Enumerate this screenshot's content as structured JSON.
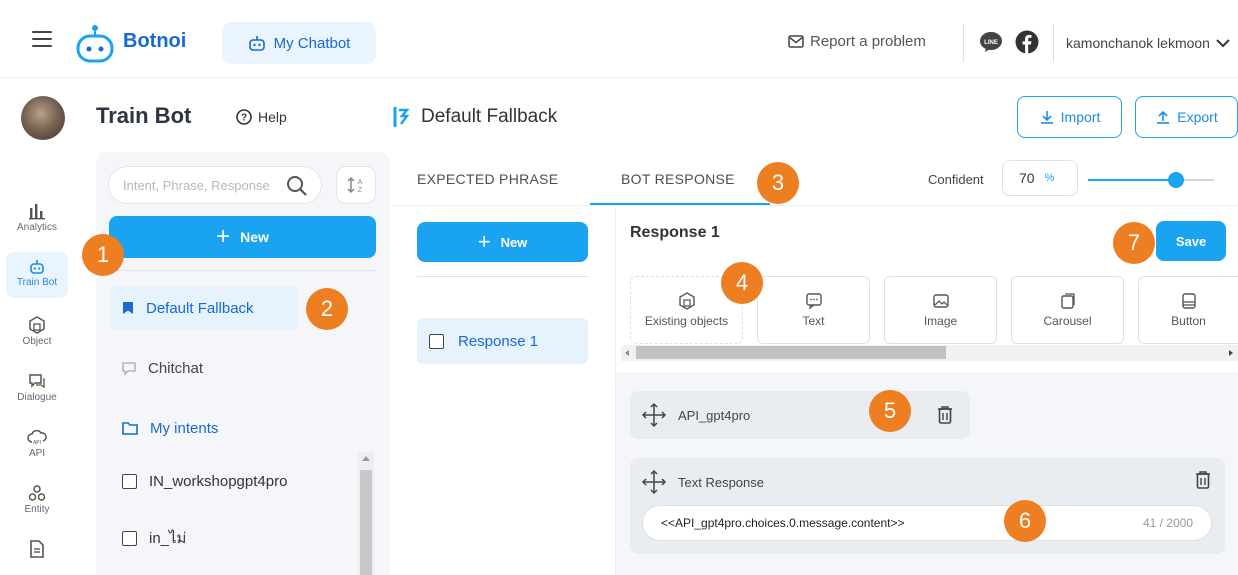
{
  "topbar": {
    "brand": "Botnoi",
    "my_chatbot": "My Chatbot",
    "report": "Report a problem",
    "username": "kamonchanok lekmoon"
  },
  "rail": [
    {
      "label": "Analytics",
      "icon": "bar-chart-icon"
    },
    {
      "label": "Train Bot",
      "icon": "robot-icon"
    },
    {
      "label": "Object",
      "icon": "cube-icon"
    },
    {
      "label": "Dialogue",
      "icon": "chat-bubble-icon"
    },
    {
      "label": "API",
      "icon": "cloud-api-icon"
    },
    {
      "label": "Entity",
      "icon": "entity-icon"
    },
    {
      "label": "",
      "icon": "document-icon"
    }
  ],
  "header": {
    "title": "Train Bot",
    "help": "Help",
    "intent_title": "Default Fallback",
    "import": "Import",
    "export": "Export"
  },
  "intents": {
    "search_placeholder": "Intent, Phrase, Response",
    "new_label": "New",
    "default_fallback": "Default Fallback",
    "chitchat": "Chitchat",
    "my_intents": "My intents",
    "items": [
      "IN_workshopgpt4pro",
      "in_ไม่"
    ]
  },
  "tabs": {
    "expected": "EXPECTED PHRASE",
    "response": "BOT RESPONSE",
    "confident_label": "Confident",
    "confident_value": "70",
    "confident_unit": "%",
    "confident_level": 0.7
  },
  "responses": {
    "new_label": "New",
    "items": [
      "Response 1"
    ]
  },
  "editor": {
    "title": "Response 1",
    "save": "Save",
    "types": [
      "Existing objects",
      "Text",
      "Image",
      "Carousel",
      "Button"
    ],
    "api_name": "API_gpt4pro",
    "text_label": "Text Response",
    "text_value": "<<API_gpt4pro.choices.0.message.content>>",
    "counter": "41 / 2000"
  },
  "markers": [
    "1",
    "2",
    "3",
    "4",
    "5",
    "6",
    "7"
  ],
  "colors": {
    "accent": "#1aa3f0",
    "brand": "#1769d6",
    "marker": "#ee7e22"
  }
}
